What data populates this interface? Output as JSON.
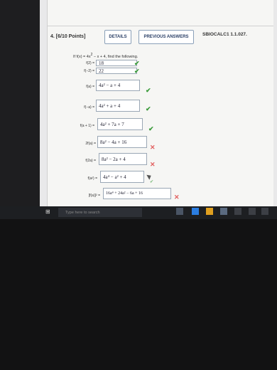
{
  "question": {
    "number_label": "4. [6/10 Points]",
    "details_button": "DETAILS",
    "previous_answers_button": "PREVIOUS ANSWERS",
    "problem_code": "SBIOCALC1 1.1.027.",
    "prompt_pre": "If f(x) = 4x",
    "prompt_exp": "2",
    "prompt_post": " − x + 4, find the following."
  },
  "parts": [
    {
      "label": "f(2) =",
      "answer": "18",
      "status": "correct"
    },
    {
      "label": "f(−2) =",
      "answer": "22",
      "status": "correct"
    },
    {
      "label": "f(a) =",
      "answer": "4a² − a + 4",
      "status": "correct"
    },
    {
      "label": "f(−a) =",
      "answer": "4a² + a + 4",
      "status": "correct"
    },
    {
      "label": "f(a + 1) =",
      "answer": "4a² + 7a + 7",
      "status": "correct"
    },
    {
      "label": "2f(a) =",
      "answer": "8a² − 4a + 16",
      "status": "incorrect"
    },
    {
      "label": "f(2a) =",
      "answer": "8a² − 2a + 4",
      "status": "incorrect"
    },
    {
      "label": "f(a²) =",
      "answer": "4a⁴ − a² + 4",
      "status": "partial"
    },
    {
      "label": "[f(a)]² =",
      "answer": "16a⁴ + 24a² − 6a + 16",
      "status": "incorrect"
    }
  ],
  "marks": {
    "correct": "✔",
    "incorrect": "✕",
    "partial": "✔"
  },
  "taskbar": {
    "search_placeholder": "Type here to search",
    "start_icon": "windows-icon"
  },
  "colors": {
    "correct": "#3a9b3a",
    "incorrect": "#e26060",
    "button_text": "#2a3f66"
  }
}
